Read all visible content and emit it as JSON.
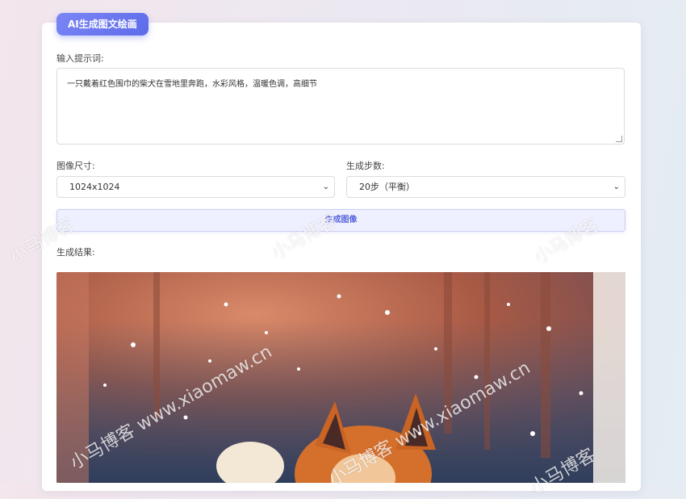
{
  "header": {
    "title": "AI生成图文绘画"
  },
  "prompt": {
    "label": "输入提示词:",
    "value": "一只戴着红色围巾的柴犬在雪地里奔跑，水彩风格，温暖色调，高细节"
  },
  "options": {
    "size_label": "图像尺寸:",
    "size_value": "1024x1024",
    "steps_label": "生成步数:",
    "steps_value": "20步（平衡）"
  },
  "actions": {
    "generate_label": "生成图像"
  },
  "result": {
    "label": "生成结果:"
  },
  "watermark": {
    "text_a": "小马博客 www.xiaomaw.cn",
    "text_b": "小马博客"
  },
  "colors": {
    "accent": "#5e6bea",
    "button_bg": "#eeefff",
    "button_text": "#5b66db"
  }
}
